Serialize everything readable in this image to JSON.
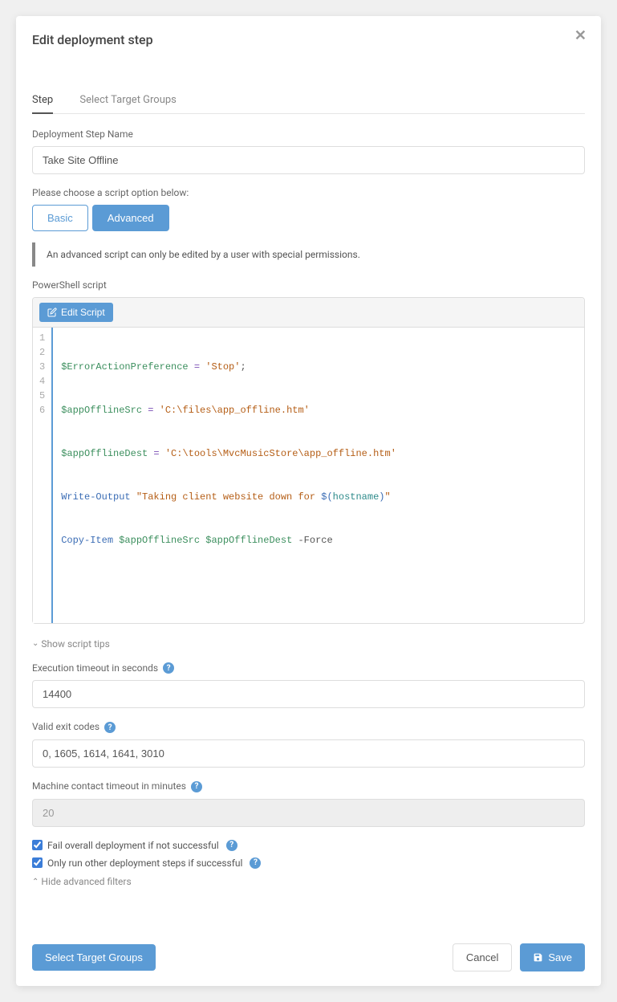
{
  "modal": {
    "title": "Edit deployment step"
  },
  "tabs": {
    "step": "Step",
    "targetGroups": "Select Target Groups"
  },
  "form": {
    "nameLabel": "Deployment Step Name",
    "nameValue": "Take Site Offline",
    "scriptOptionLabel": "Please choose a script option below:",
    "basicBtn": "Basic",
    "advancedBtn": "Advanced",
    "advancedNote": "An advanced script can only be edited by a user with special permissions.",
    "powershellLabel": "PowerShell script",
    "editScriptBtn": "Edit Script",
    "showTips": "Show script tips",
    "timeoutLabel": "Execution timeout in seconds",
    "timeoutValue": "14400",
    "exitCodesLabel": "Valid exit codes",
    "exitCodesValue": "0, 1605, 1614, 1641, 3010",
    "contactTimeoutLabel": "Machine contact timeout in minutes",
    "contactTimeoutValue": "20",
    "failCheckbox": "Fail overall deployment if not successful",
    "runOtherCheckbox": "Only run other deployment steps if successful",
    "hideFilters": "Hide advanced filters"
  },
  "script": {
    "lines": [
      "1",
      "2",
      "3",
      "4",
      "5",
      "6"
    ],
    "l1": {
      "a": "$ErrorActionPreference",
      "b": " = ",
      "c": "'Stop'",
      "d": ";"
    },
    "l2": {
      "a": "$appOfflineSrc",
      "b": " = ",
      "c": "'C:\\files\\app_offline.htm'"
    },
    "l3": {
      "a": "$appOfflineDest",
      "b": " = ",
      "c": "'C:\\tools\\MvcMusicStore\\app_offline.htm'"
    },
    "l4": {
      "a": "Write-Output",
      "b": " \"Taking client website down for ",
      "c": "$(",
      "d": "hostname",
      "e": ")",
      "f": "\""
    },
    "l5": {
      "a": "Copy-Item",
      "b": " ",
      "c": "$appOfflineSrc",
      "d": " ",
      "e": "$appOfflineDest",
      "f": " -Force"
    }
  },
  "footer": {
    "selectTargets": "Select Target Groups",
    "cancel": "Cancel",
    "save": "Save"
  }
}
